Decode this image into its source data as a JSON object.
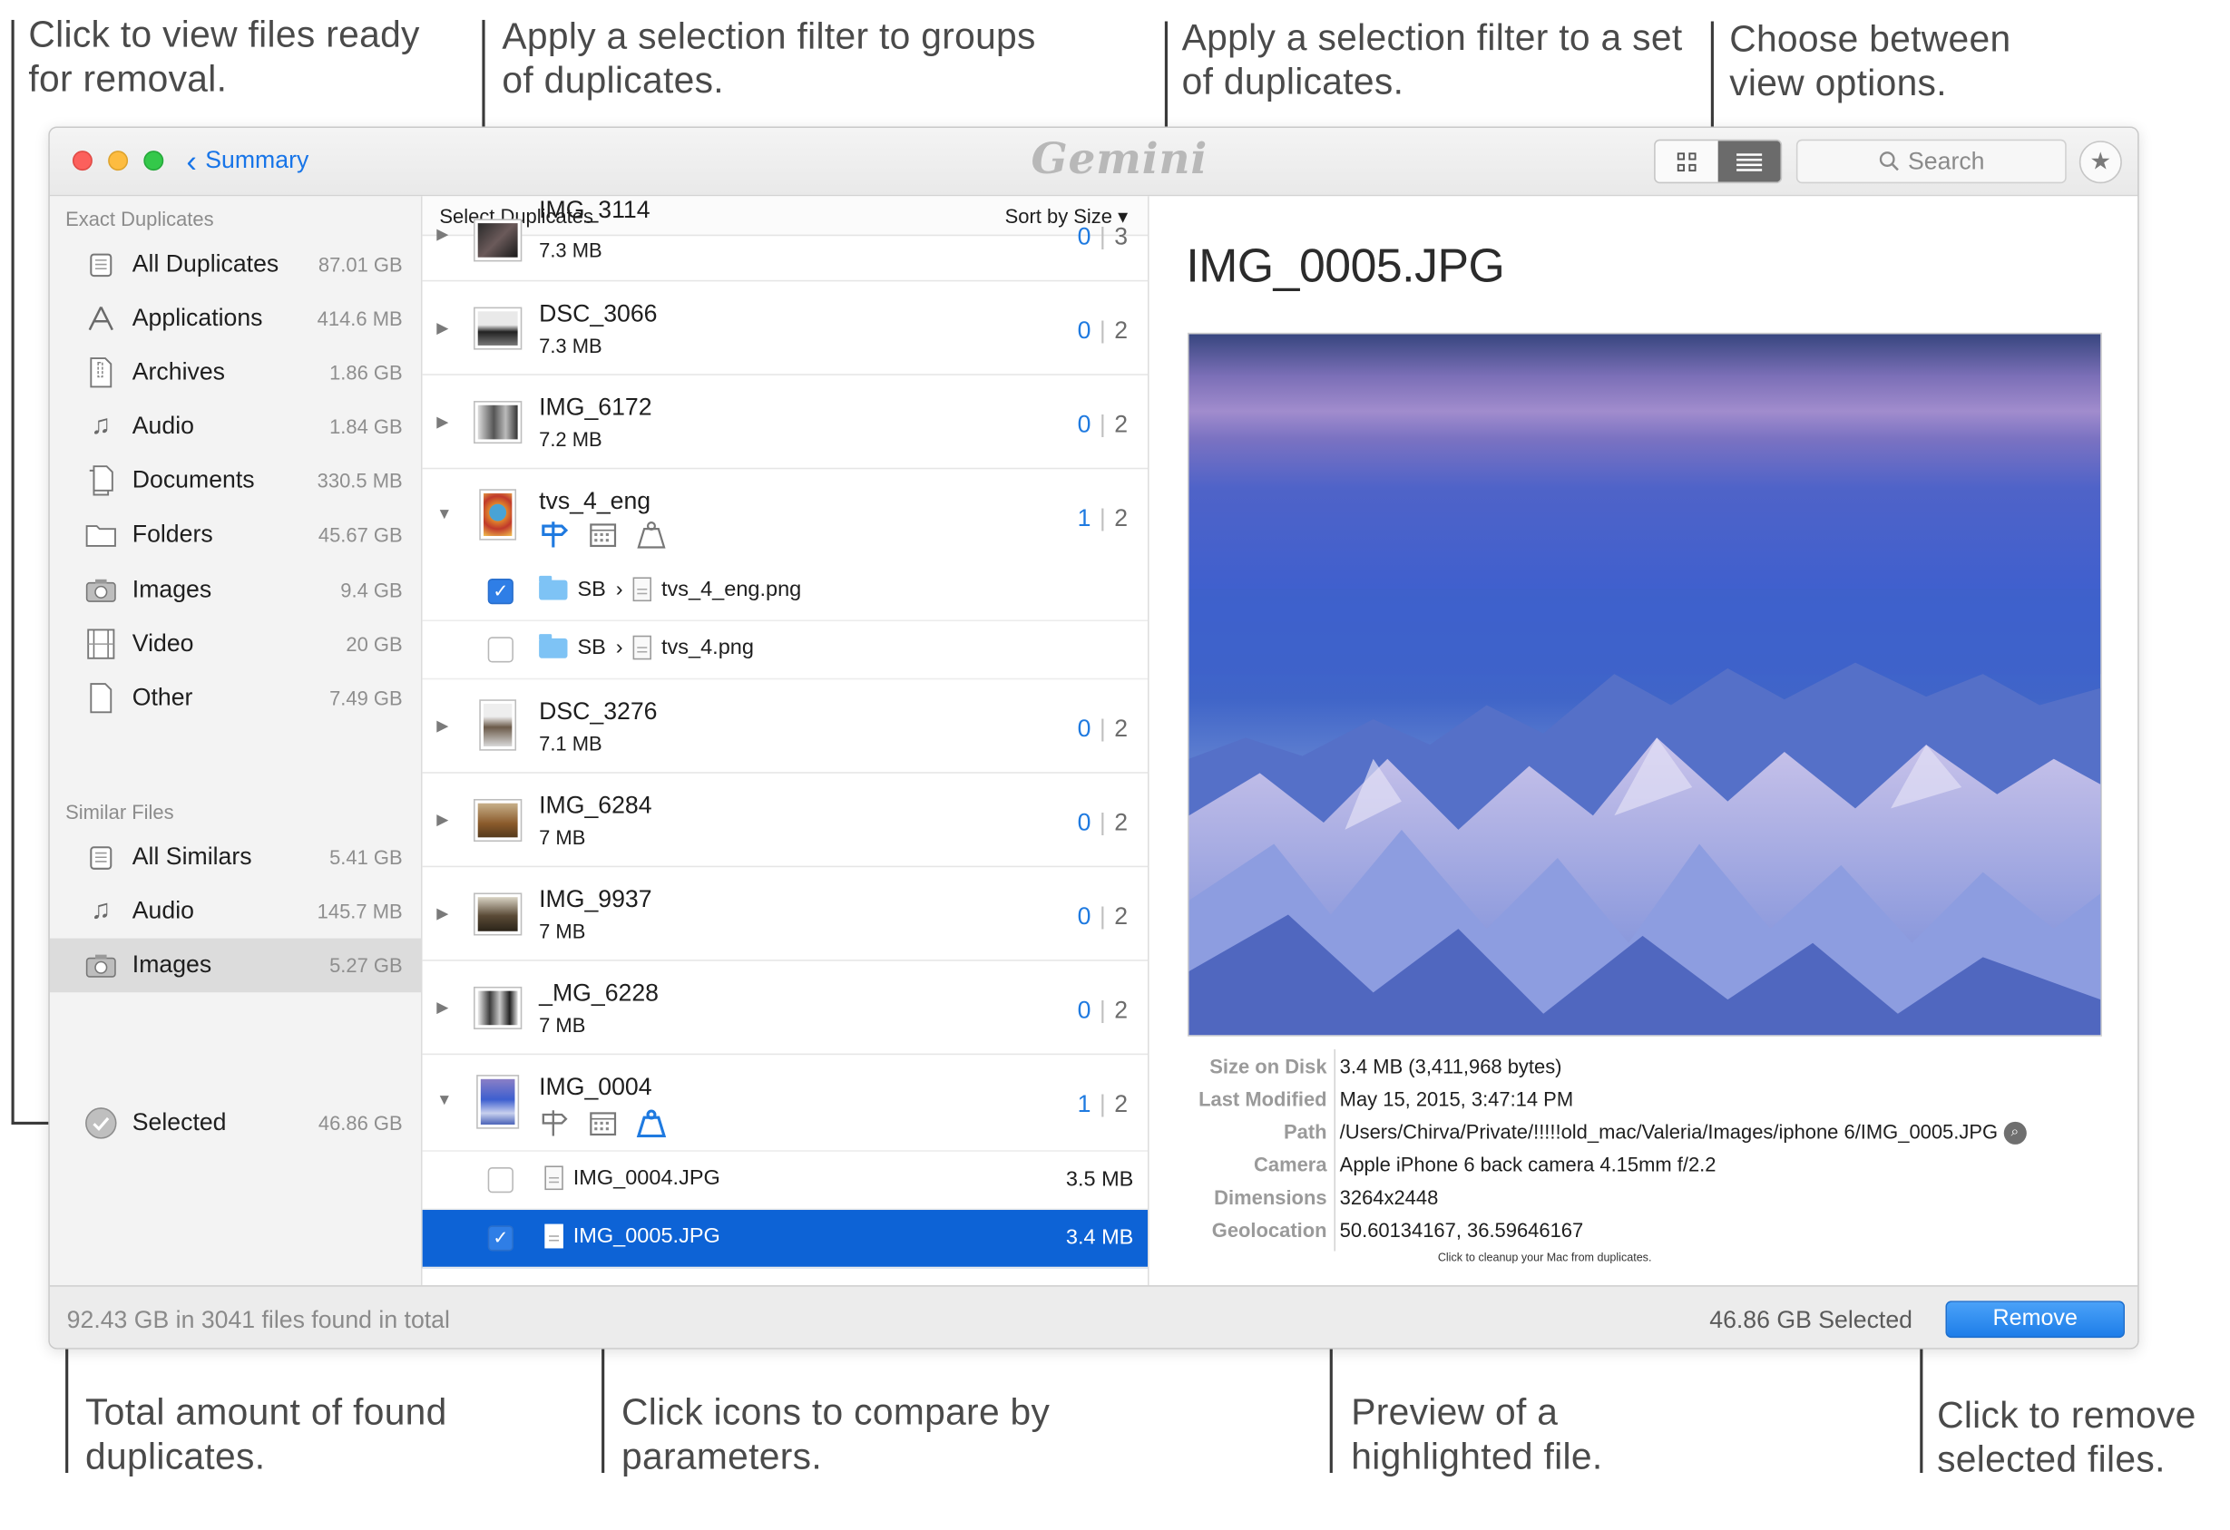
{
  "callouts": {
    "view_files": "Click to view files ready for removal.",
    "group_filter": "Apply a selection filter to groups of duplicates.",
    "set_filter": "Apply a selection filter to a set of duplicates.",
    "view_options": "Choose between view options.",
    "total_amount": "Total amount of found duplicates.",
    "compare_icons": "Click icons to compare by parameters.",
    "preview": "Preview of a highlighted file.",
    "remove_files": "Click to remove selected files."
  },
  "titlebar": {
    "back_label": "Summary",
    "logo": "Gemini",
    "search_placeholder": "Search",
    "view_grid_icon": "grid-icon",
    "view_list_icon": "list-icon",
    "favorite_icon": "star-icon"
  },
  "sidebar": {
    "exact_header": "Exact Duplicates",
    "exact": [
      {
        "label": "All Duplicates",
        "size": "87.01 GB",
        "icon": "stack-icon"
      },
      {
        "label": "Applications",
        "size": "414.6 MB",
        "icon": "applications-icon"
      },
      {
        "label": "Archives",
        "size": "1.86 GB",
        "icon": "archive-icon"
      },
      {
        "label": "Audio",
        "size": "1.84 GB",
        "icon": "music-note-icon"
      },
      {
        "label": "Documents",
        "size": "330.5 MB",
        "icon": "documents-icon"
      },
      {
        "label": "Folders",
        "size": "45.67 GB",
        "icon": "folder-icon"
      },
      {
        "label": "Images",
        "size": "9.4 GB",
        "icon": "camera-icon"
      },
      {
        "label": "Video",
        "size": "20 GB",
        "icon": "film-icon"
      },
      {
        "label": "Other",
        "size": "7.49 GB",
        "icon": "file-icon"
      }
    ],
    "similar_header": "Similar Files",
    "similar": [
      {
        "label": "All Similars",
        "size": "5.41 GB",
        "icon": "stack-icon"
      },
      {
        "label": "Audio",
        "size": "145.7 MB",
        "icon": "music-note-icon"
      },
      {
        "label": "Images",
        "size": "5.27 GB",
        "icon": "camera-icon"
      }
    ],
    "selected": {
      "label": "Selected",
      "size": "46.86 GB",
      "icon": "check-circle-icon"
    }
  },
  "list": {
    "select_label": "Select Duplicates",
    "sort_label": "Sort by Size",
    "groups": [
      {
        "name": "IMG_3114",
        "size": "7.3 MB",
        "selected": "0",
        "total": "3"
      },
      {
        "name": "DSC_3066",
        "size": "7.3 MB",
        "selected": "0",
        "total": "2"
      },
      {
        "name": "IMG_6172",
        "size": "7.2 MB",
        "selected": "0",
        "total": "2"
      },
      {
        "name": "tvs_4_eng",
        "selected": "1",
        "total": "2",
        "files": [
          {
            "folder": "SB",
            "file": "tvs_4_eng.png",
            "checked": true
          },
          {
            "folder": "SB",
            "file": "tvs_4.png",
            "checked": false
          }
        ]
      },
      {
        "name": "DSC_3276",
        "size": "7.1 MB",
        "selected": "0",
        "total": "2"
      },
      {
        "name": "IMG_6284",
        "size": "7 MB",
        "selected": "0",
        "total": "2"
      },
      {
        "name": "IMG_9937",
        "size": "7 MB",
        "selected": "0",
        "total": "2"
      },
      {
        "name": "_MG_6228",
        "size": "7 MB",
        "selected": "0",
        "total": "2"
      },
      {
        "name": "IMG_0004",
        "selected": "1",
        "total": "2",
        "files": [
          {
            "file": "IMG_0004.JPG",
            "size": "3.5 MB",
            "checked": false
          },
          {
            "file": "IMG_0005.JPG",
            "size": "3.4 MB",
            "checked": true
          }
        ]
      }
    ],
    "compare_icons": [
      "signpost-icon",
      "calendar-icon",
      "weight-icon"
    ]
  },
  "preview": {
    "title": "IMG_0005.JPG",
    "meta": [
      {
        "key": "Size on Disk",
        "value": "3.4 MB (3,411,968 bytes)"
      },
      {
        "key": "Last Modified",
        "value": "May 15, 2015, 3:47:14 PM"
      },
      {
        "key": "Path",
        "value": "/Users/Chirva/Private/!!!!!old_mac/Valeria/Images/iphone 6/IMG_0005.JPG"
      },
      {
        "key": "Camera",
        "value": "Apple iPhone 6 back camera 4.15mm f/2.2"
      },
      {
        "key": "Dimensions",
        "value": "3264x2448"
      },
      {
        "key": "Geolocation",
        "value": "50.60134167, 36.59646167"
      }
    ],
    "tooltip": "Click to cleanup your Mac from duplicates."
  },
  "footer": {
    "total": "92.43 GB in 3041 files found in total",
    "selected": "46.86 GB Selected",
    "remove_label": "Remove"
  },
  "colors": {
    "accent": "#1f7ae0",
    "highlight_row": "#0d63d6",
    "remove_button": "#2484ec"
  }
}
